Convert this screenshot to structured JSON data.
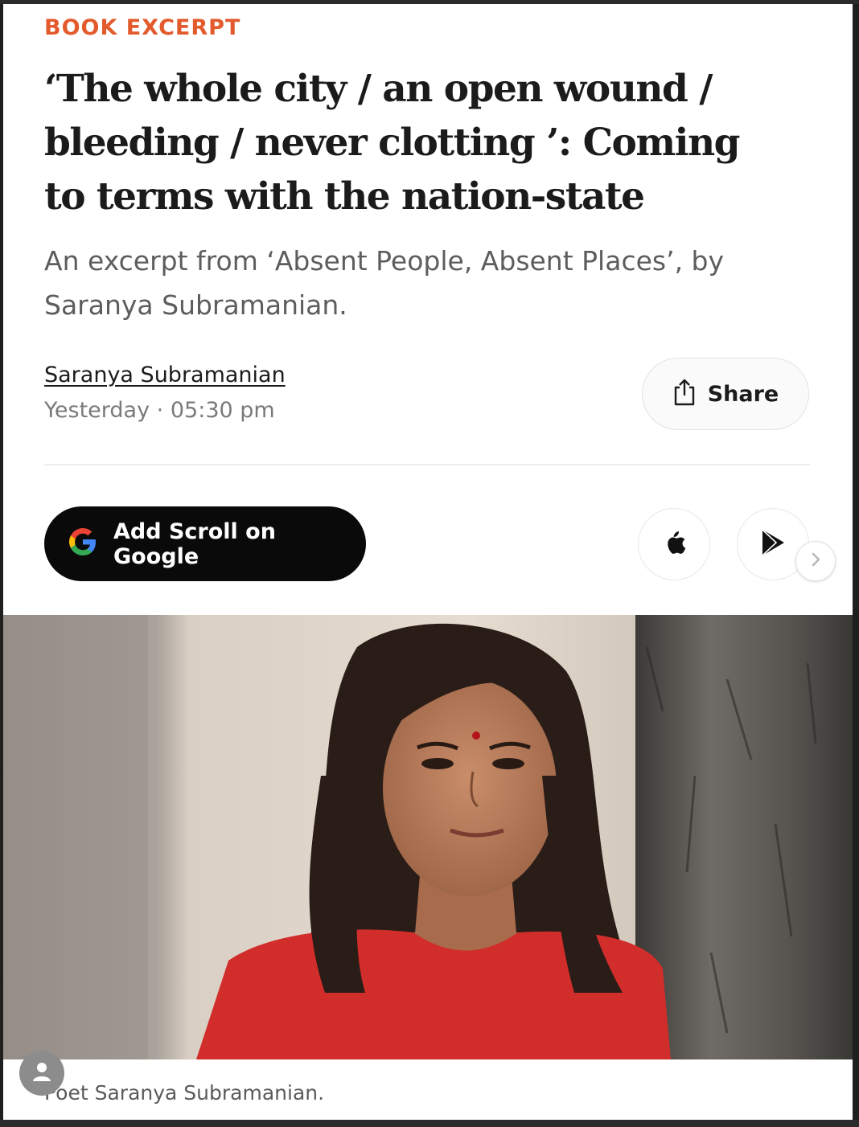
{
  "article": {
    "kicker": "BOOK EXCERPT",
    "headline": "‘The whole city / an open wound / bleeding / never clotting ’: Coming to terms with the nation-state",
    "subheadline": "An excerpt from ‘Absent People, Absent Places’, by Saranya Subramanian.",
    "author": "Saranya Subramanian",
    "date": "Yesterday",
    "separator": "·",
    "time": "05:30 pm"
  },
  "actions": {
    "share_label": "Share",
    "google_label": "Add Scroll on Google",
    "apple_icon": "apple-icon",
    "play_icon": "play-store-icon",
    "next_icon": "chevron-right-icon"
  },
  "photo": {
    "caption": "Poet Saranya Subramanian."
  },
  "colors": {
    "kicker": "#e35b2c",
    "google_button_bg": "#0a0a0a"
  }
}
